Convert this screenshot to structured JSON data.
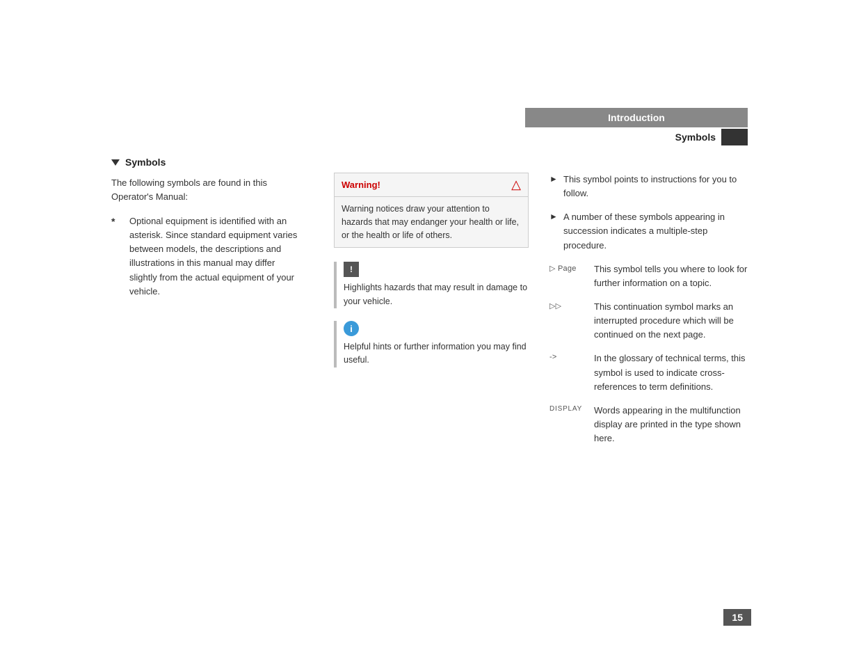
{
  "header": {
    "intro_label": "Introduction",
    "symbols_label": "Symbols"
  },
  "left": {
    "heading": "Symbols",
    "intro_text": "The following symbols are found in this Operator's Manual:",
    "item_asterisk": "*",
    "item_text": "Optional equipment is identified with an asterisk. Since standard equipment varies between models, the descriptions and illustrations in this manual may differ slightly from the actual equipment of your vehicle."
  },
  "middle": {
    "warning_label": "Warning!",
    "warning_body": "Warning notices draw your attention to hazards that may endanger your health or life, or the health or life of others.",
    "caution_icon": "!",
    "caution_text": "Highlights hazards that may result in damage to your vehicle.",
    "info_icon": "i",
    "info_text": "Helpful hints or further information you may find useful."
  },
  "right": {
    "item1_text": "This symbol points to instructions for you to follow.",
    "item2_text": "A number of these symbols appearing in succession indicates a multiple-step procedure.",
    "page_label": "▷ Page",
    "page_desc": "This symbol tells you where to look for further information on a topic.",
    "continuation_label": "▷▷",
    "continuation_desc": "This continuation symbol marks an interrupted procedure which will be continued on the next page.",
    "glossary_label": "->",
    "glossary_desc": "In the glossary of technical terms, this symbol is used to indicate cross-references to term definitions.",
    "display_label": "DISPLAY",
    "display_desc": "Words appearing in the multifunction display are printed in the type shown here."
  },
  "footer": {
    "page_number": "15"
  }
}
